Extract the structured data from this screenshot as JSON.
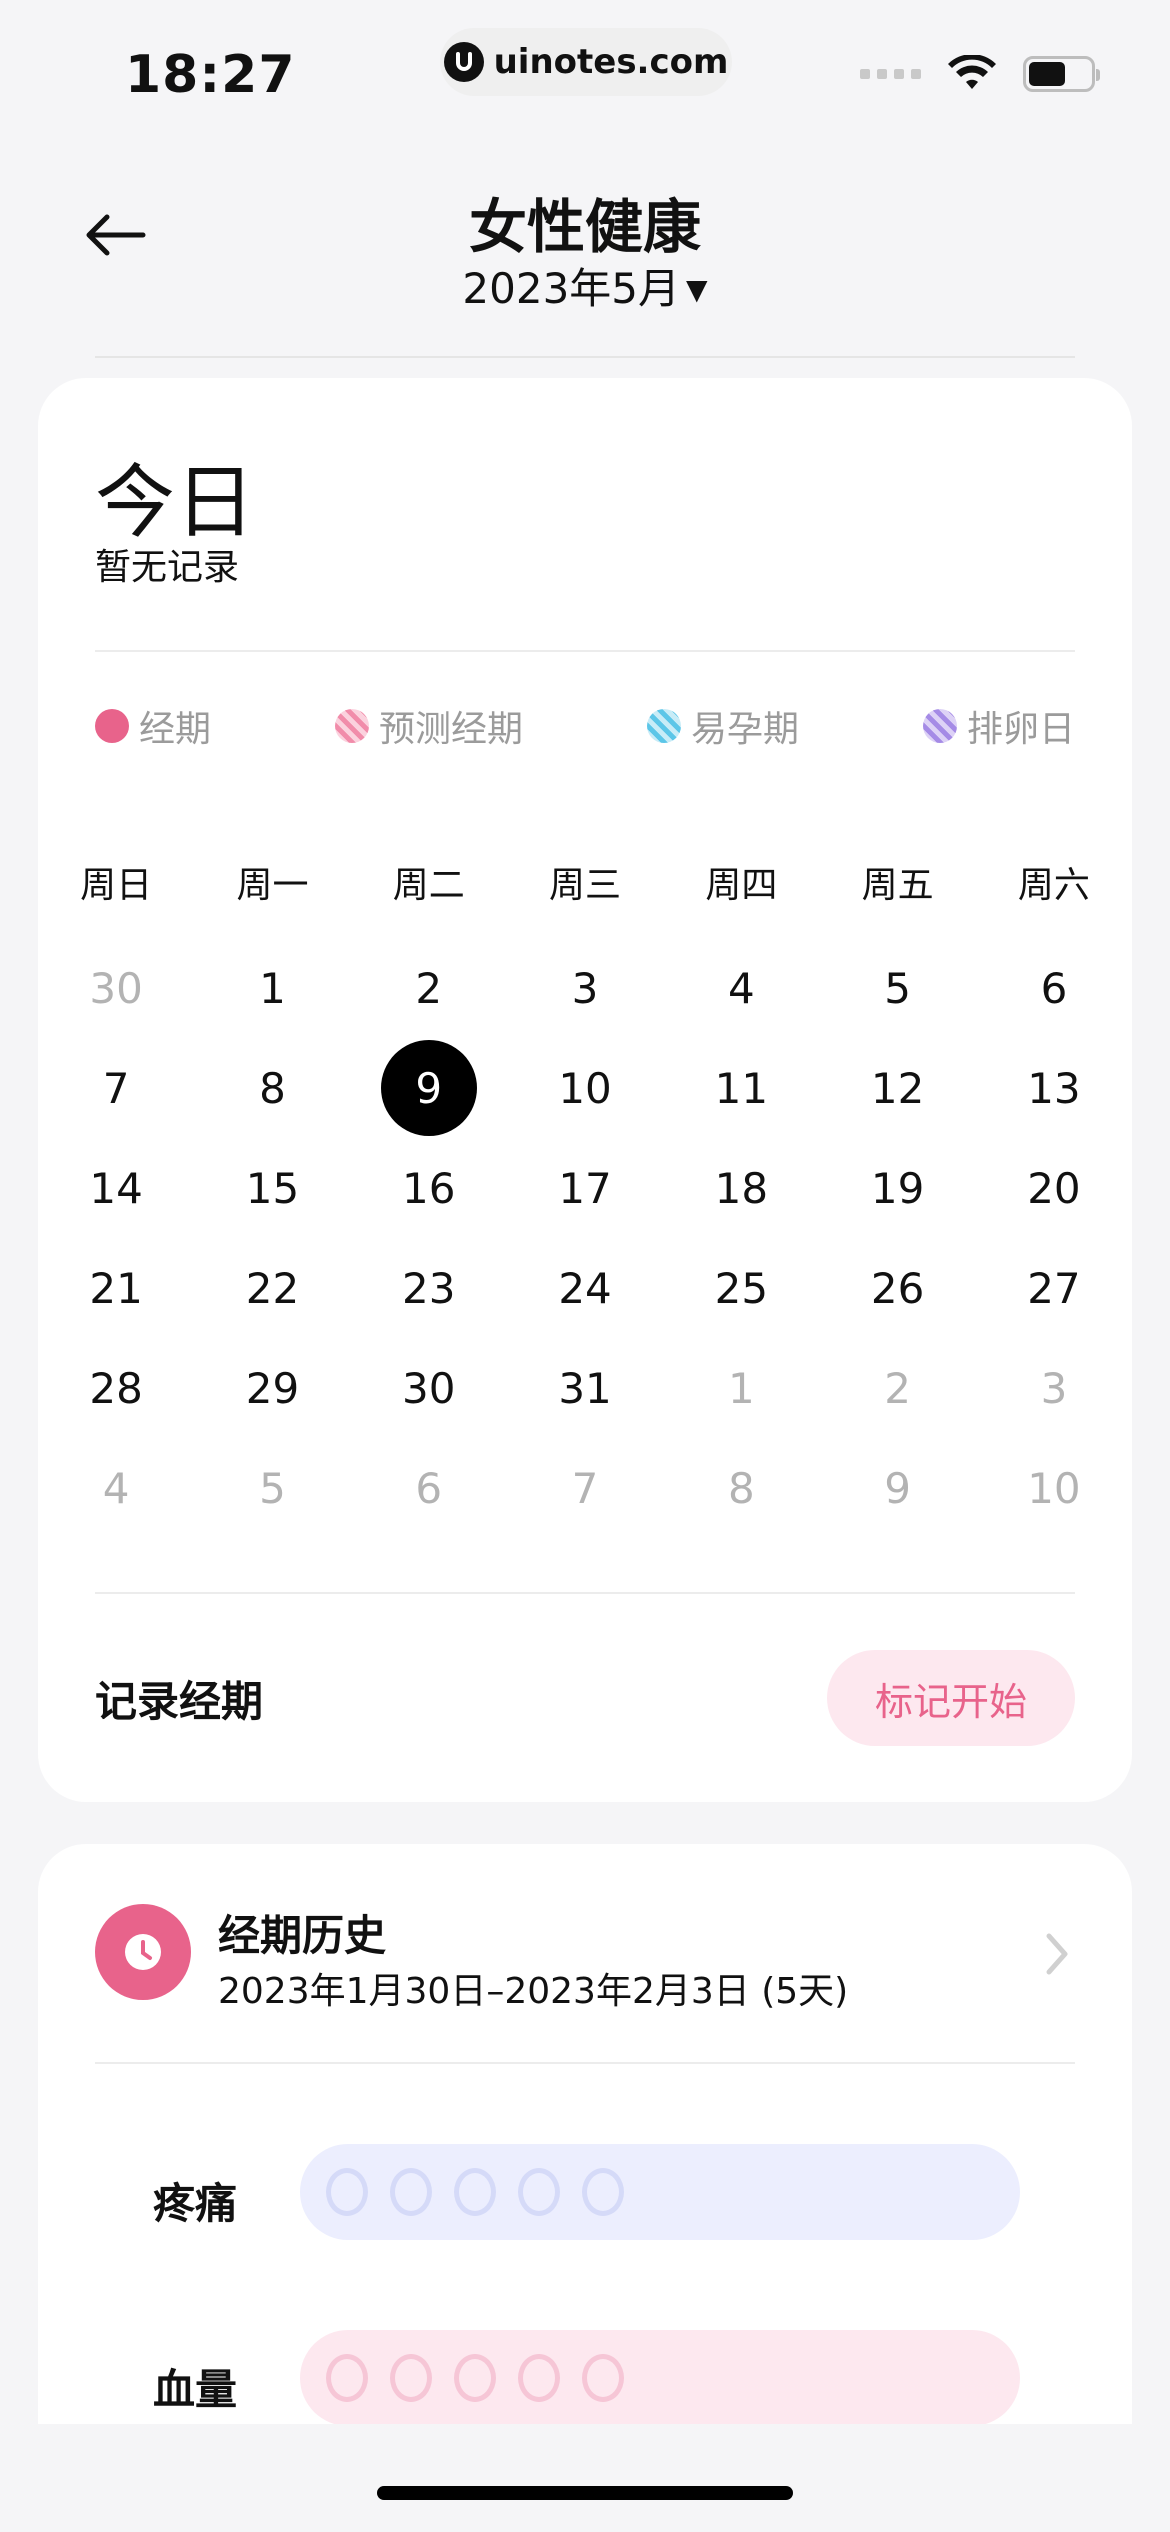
{
  "status": {
    "time": "18:27",
    "url": "uinotes.com"
  },
  "header": {
    "title": "女性健康",
    "month": "2023年5月"
  },
  "today": {
    "title": "今日",
    "subtitle": "暂无记录"
  },
  "legend": [
    {
      "label": "经期",
      "color": "#e8638b"
    },
    {
      "label": "预测经期",
      "color": "#f18caa"
    },
    {
      "label": "易孕期",
      "color": "#5cc6e8"
    },
    {
      "label": "排卵日",
      "color": "#a58be6"
    }
  ],
  "calendar": {
    "weekdays": [
      "周日",
      "周一",
      "周二",
      "周三",
      "周四",
      "周五",
      "周六"
    ],
    "days": [
      "30",
      "1",
      "2",
      "3",
      "4",
      "5",
      "6",
      "7",
      "8",
      "9",
      "10",
      "11",
      "12",
      "13",
      "14",
      "15",
      "16",
      "17",
      "18",
      "19",
      "20",
      "21",
      "22",
      "23",
      "24",
      "25",
      "26",
      "27",
      "28",
      "29",
      "30",
      "31",
      "1",
      "2",
      "3",
      "4",
      "5",
      "6",
      "7",
      "8",
      "9",
      "10"
    ],
    "muted_indices": [
      0,
      32,
      33,
      34,
      35,
      36,
      37,
      38,
      39,
      40,
      41
    ],
    "selected_index": 9
  },
  "record": {
    "label": "记录经期",
    "button": "标记开始"
  },
  "history": {
    "title": "经期历史",
    "range": "2023年1月30日–2023年2月3日 (5天)"
  },
  "metrics": {
    "pain_label": "疼痛",
    "flow_label": "血量",
    "pain_level": 0,
    "flow_level": 0,
    "max_level": 5
  },
  "colors": {
    "accent": "#e8638b",
    "accent_bg": "#fde8ef",
    "pain_bg": "#eceefe"
  }
}
